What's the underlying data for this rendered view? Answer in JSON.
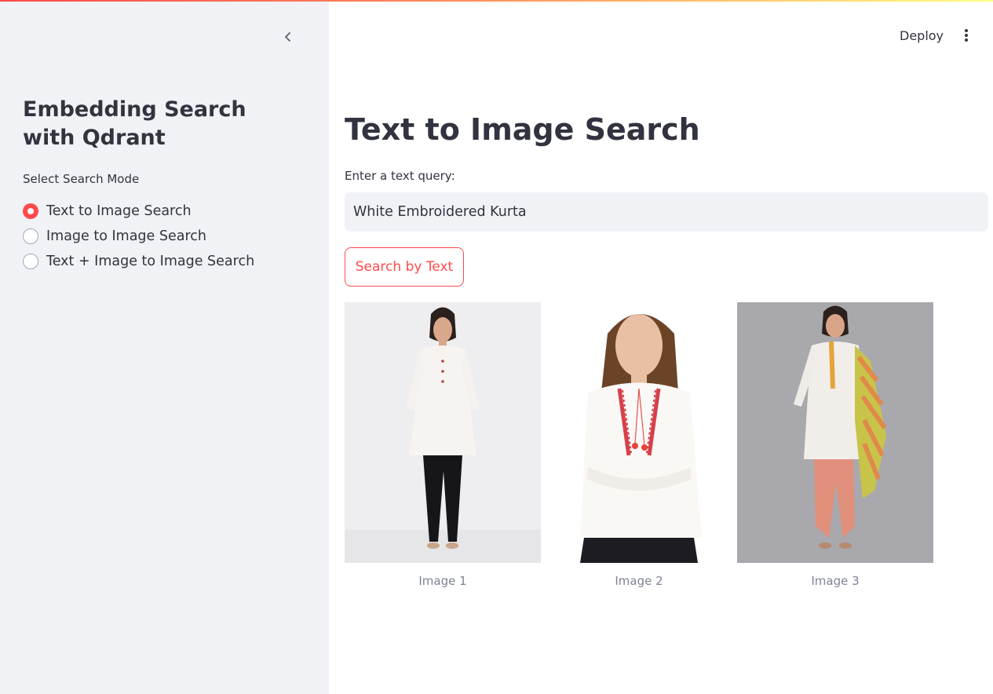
{
  "sidebar": {
    "title": "Embedding Search with Qdrant",
    "radio_label": "Select Search Mode",
    "options": [
      {
        "label": "Text to Image Search",
        "selected": true
      },
      {
        "label": "Image to Image Search",
        "selected": false
      },
      {
        "label": "Text + Image to Image Search",
        "selected": false
      }
    ]
  },
  "header": {
    "deploy_label": "Deploy",
    "menu_icon": "vertical-ellipsis-icon",
    "collapse_icon": "chevron-left-icon"
  },
  "main": {
    "title": "Text to Image Search",
    "input_label": "Enter a text query:",
    "input_value": "White Embroidered Kurta",
    "search_button": "Search by Text",
    "results": [
      {
        "caption": "Image 1"
      },
      {
        "caption": "Image 2"
      },
      {
        "caption": "Image 3"
      }
    ]
  },
  "colors": {
    "accent": "#ff4b4b",
    "sidebar_bg": "#f0f2f6",
    "text": "#31333f",
    "caption": "#808495"
  }
}
